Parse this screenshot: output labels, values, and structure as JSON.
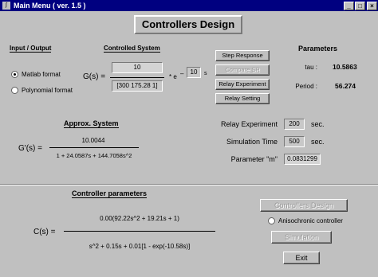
{
  "window": {
    "title": "Main Menu ( ver. 1.5 )",
    "icon": "matlab-icon"
  },
  "main_title": "Controllers Design",
  "io": {
    "header": "Input / Output",
    "options": [
      "Matlab format",
      "Polynomial format"
    ],
    "selected": "Matlab format"
  },
  "controlled_system": {
    "header": "Controlled System",
    "lhs": "G(s)  =",
    "numerator": "10",
    "denominator": "[300 175.28 1]",
    "delay_prefix": "* e",
    "delay_minus": "–",
    "delay_value": "10",
    "delay_suffix": "s"
  },
  "buttons": {
    "step_response": "Step Response",
    "compare_sr": "Compare SR",
    "relay_experiment": "Relay Experiment",
    "relay_setting": "Relay Setting",
    "controllers_design": "Controllers Design",
    "simulation": "Simulation",
    "exit": "Exit"
  },
  "parameters": {
    "header": "Parameters",
    "tau_label": "tau :",
    "tau_value": "10.5863",
    "period_label": "Period :",
    "period_value": "56.274"
  },
  "approx_system": {
    "header": "Approx. System",
    "lhs": "G'(s)  =",
    "numerator": "10.0044",
    "denominator": "1 + 24.0587s + 144.7058s^2"
  },
  "settings": {
    "relay_label": "Relay Experiment",
    "relay_value": "200",
    "relay_unit": "sec.",
    "sim_label": "Simulation Time",
    "sim_value": "500",
    "sim_unit": "sec.",
    "m_label": "Parameter  \"m\"",
    "m_value": "0.0831299"
  },
  "controller": {
    "header": "Controller parameters",
    "lhs": "C(s)  =",
    "numerator": "0.00(92.22s^2 + 19.21s + 1)",
    "denominator": "s^2 + 0.15s + 0.01[1 - exp(-10.58s)]",
    "anisochronic_label": "Anisochronic controller"
  }
}
